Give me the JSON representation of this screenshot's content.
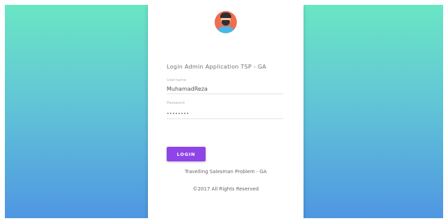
{
  "login": {
    "title": "Login Admin Application TSP - GA",
    "username_label": "Username",
    "username_value": "MuhamadReza",
    "password_label": "Password",
    "password_value": "password",
    "button_label": "LOGIN"
  },
  "footer": {
    "app_name": "Travelling Salesman Problem - GA",
    "copyright": "©2017 All Rights Reserved"
  },
  "colors": {
    "gradient_top": "#6ae6c4",
    "gradient_bottom": "#4f96e2",
    "button": "#8e44e6",
    "avatar_bg": "#ee6e4f"
  }
}
